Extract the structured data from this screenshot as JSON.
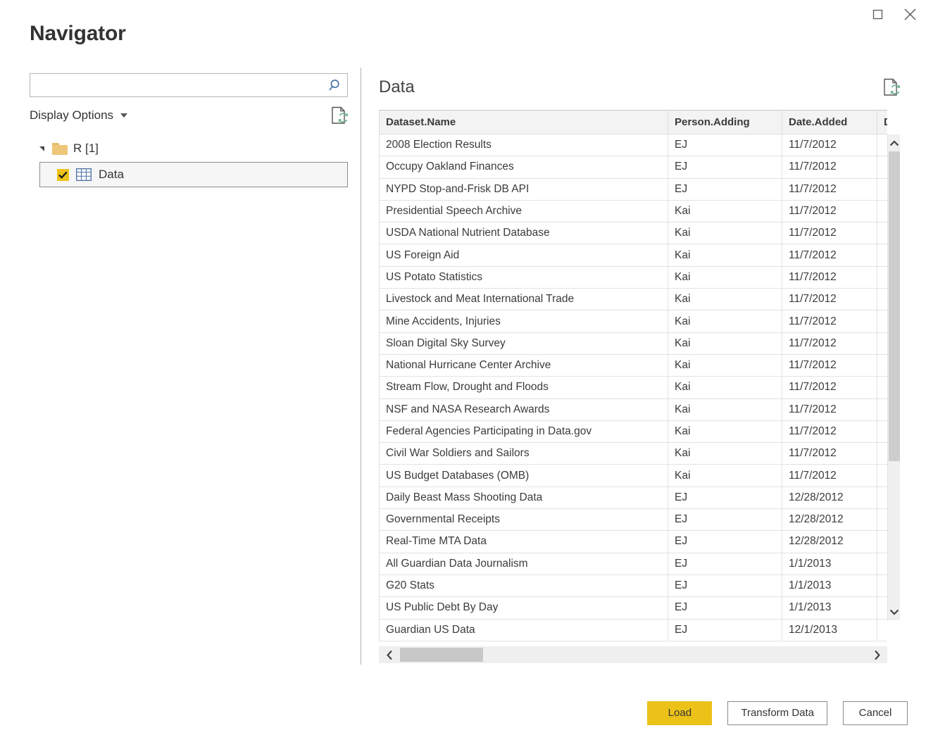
{
  "window": {
    "title": "Navigator",
    "controls": [
      {
        "name": "maximize",
        "label": "Maximize"
      },
      {
        "name": "close",
        "label": "Close"
      }
    ]
  },
  "search": {
    "value": "",
    "placeholder": "",
    "icon": "search-icon"
  },
  "left": {
    "display_options_label": "Display Options",
    "refresh_icon": "refresh-document-icon",
    "tree": {
      "root": {
        "label": "R [1]",
        "expanded": true,
        "icon": "folder-icon"
      },
      "children": [
        {
          "label": "Data",
          "checked": true,
          "selected": true,
          "icon": "table-grid-icon"
        }
      ]
    }
  },
  "right": {
    "preview_title": "Data",
    "refresh_icon": "refresh-document-icon",
    "table": {
      "columns": [
        "Dataset.Name",
        "Person.Adding",
        "Date.Added",
        "Dat"
      ],
      "rows": [
        [
          "2008 Election Results",
          "EJ",
          "11/7/2012",
          ""
        ],
        [
          "Occupy Oakland Finances",
          "EJ",
          "11/7/2012",
          ""
        ],
        [
          "NYPD Stop-and-Frisk DB API",
          "EJ",
          "11/7/2012",
          ""
        ],
        [
          "Presidential Speech Archive",
          "Kai",
          "11/7/2012",
          ""
        ],
        [
          "USDA National Nutrient Database",
          "Kai",
          "11/7/2012",
          ""
        ],
        [
          "US Foreign Aid",
          "Kai",
          "11/7/2012",
          ""
        ],
        [
          "US Potato Statistics",
          "Kai",
          "11/7/2012",
          ""
        ],
        [
          "Livestock and Meat International Trade",
          "Kai",
          "11/7/2012",
          ""
        ],
        [
          "Mine Accidents, Injuries",
          "Kai",
          "11/7/2012",
          ""
        ],
        [
          "Sloan Digital Sky Survey",
          "Kai",
          "11/7/2012",
          ""
        ],
        [
          "National Hurricane Center Archive",
          "Kai",
          "11/7/2012",
          ""
        ],
        [
          "Stream Flow, Drought and Floods",
          "Kai",
          "11/7/2012",
          ""
        ],
        [
          "NSF and NASA Research Awards",
          "Kai",
          "11/7/2012",
          ""
        ],
        [
          "Federal Agencies Participating in Data.gov",
          "Kai",
          "11/7/2012",
          ""
        ],
        [
          "Civil War Soldiers and Sailors",
          "Kai",
          "11/7/2012",
          ""
        ],
        [
          "US Budget Databases (OMB)",
          "Kai",
          "11/7/2012",
          ""
        ],
        [
          "Daily Beast Mass Shooting Data",
          "EJ",
          "12/28/2012",
          ""
        ],
        [
          "Governmental Receipts",
          "EJ",
          "12/28/2012",
          ""
        ],
        [
          "Real-Time MTA Data",
          "EJ",
          "12/28/2012",
          ""
        ],
        [
          "All Guardian Data Journalism",
          "EJ",
          "1/1/2013",
          ""
        ],
        [
          "G20 Stats",
          "EJ",
          "1/1/2013",
          ""
        ],
        [
          "US Public Debt By Day",
          "EJ",
          "1/1/2013",
          ""
        ],
        [
          "Guardian US Data",
          "EJ",
          "12/1/2013",
          ""
        ]
      ]
    },
    "scrollbars": {
      "vertical": {
        "up_icon": "chevron-up-icon",
        "down_icon": "chevron-down-icon"
      },
      "horizontal": {
        "left_icon": "chevron-left-icon",
        "right_icon": "chevron-right-icon"
      }
    }
  },
  "footer": {
    "load_label": "Load",
    "transform_label": "Transform Data",
    "cancel_label": "Cancel"
  },
  "colors": {
    "accent_yellow": "#ECC219",
    "folder_yellow": "#EDC679",
    "search_blue": "#3D6FA8",
    "refresh_green": "#6AAF8B",
    "text": "#333333",
    "selection_bg": "#F6F6F6",
    "header_bg": "#F3F3F3"
  }
}
